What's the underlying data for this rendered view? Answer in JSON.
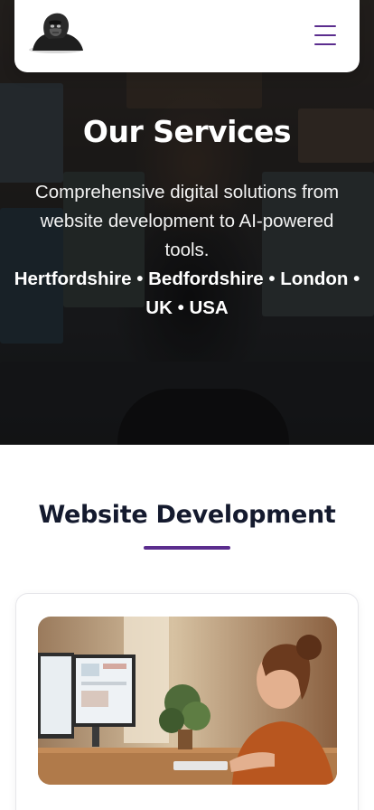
{
  "header": {
    "logo_icon": "gorilla-logo-icon",
    "menu_icon": "hamburger-menu-icon",
    "accent_color": "#5b2d8e"
  },
  "hero": {
    "title": "Our Services",
    "description": "Comprehensive digital solutions from website development to AI-powered tools.",
    "locations": "Hertfordshire • Bedfordshire • London • UK • USA",
    "background_image": "woman-working-at-computer-monitors-photo"
  },
  "section": {
    "title": "Website Development",
    "title_color": "#141a2e",
    "card_image": "woman-at-desk-with-web-design-monitors-photo"
  }
}
